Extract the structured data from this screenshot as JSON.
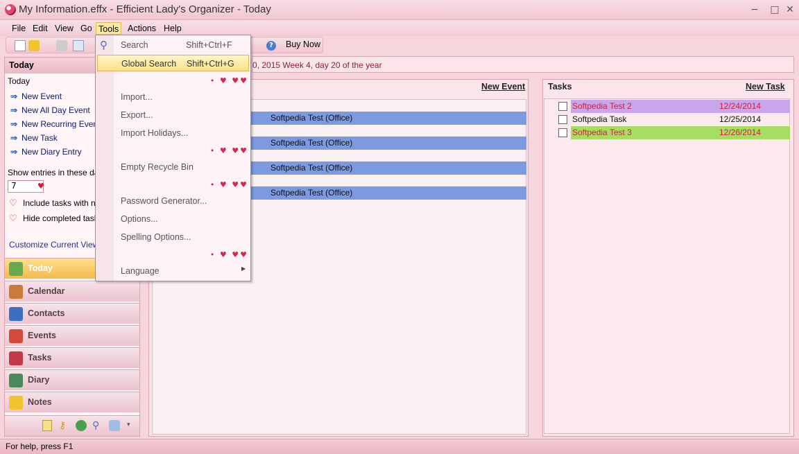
{
  "window": {
    "title": "My Information.effx - Efficient Lady's Organizer - Today",
    "controls": {
      "minimize": "−",
      "maximize": "□",
      "close": "✕"
    }
  },
  "menubar": [
    "File",
    "Edit",
    "View",
    "Go",
    "Tools",
    "Actions",
    "Help"
  ],
  "toolbar": {
    "buy_now": "Buy Now",
    "help_icon": "?"
  },
  "datebar": {
    "text": "0, 2015   Week 4, day 20 of the year"
  },
  "left_pane": {
    "header": "Today",
    "today_label": "Today",
    "links": [
      "New Event",
      "New All Day Event",
      "New Recurring Event",
      "New Task",
      "New Diary Entry"
    ],
    "show_entries_label": "Show entries in these days",
    "days_value": "7",
    "include_tasks_label": "Include tasks with no",
    "hide_completed_label": "Hide completed tasks",
    "customize_link": "Customize Current View...",
    "nav": [
      {
        "label": "Today",
        "icon": "home-icon",
        "color": "#6aa84f"
      },
      {
        "label": "Calendar",
        "icon": "calendar-icon",
        "color": "#c97b3a"
      },
      {
        "label": "Contacts",
        "icon": "contacts-icon",
        "color": "#3c6fc2"
      },
      {
        "label": "Events",
        "icon": "events-icon",
        "color": "#d14a3a"
      },
      {
        "label": "Tasks",
        "icon": "tasks-icon",
        "color": "#c23a4a"
      },
      {
        "label": "Diary",
        "icon": "diary-icon",
        "color": "#4a8a5a"
      },
      {
        "label": "Notes",
        "icon": "notes-icon",
        "color": "#f2c530"
      }
    ]
  },
  "events": {
    "new_event_label": "New Event",
    "rows": [
      "Softpedia Test (Office)",
      "Softpedia Test (Office)",
      "Softpedia Test (Office)",
      "Softpedia Test (Office)"
    ]
  },
  "tasks": {
    "title": "Tasks",
    "new_task_label": "New Task",
    "rows": [
      {
        "name": "Softpedia Test 2",
        "date": "12/24/2014",
        "bg": "#c9a5ec",
        "color": "#d0203c"
      },
      {
        "name": "Softpedia Task",
        "date": "12/25/2014",
        "bg": "",
        "color": "#111111"
      },
      {
        "name": "Softpedia Test 3",
        "date": "12/26/2014",
        "bg": "#a6de62",
        "color": "#d0203c"
      }
    ]
  },
  "tools_menu": {
    "search": {
      "label": "Search",
      "shortcut": "Shift+Ctrl+F"
    },
    "global_search": {
      "label": "Global Search",
      "shortcut": "Shift+Ctrl+G"
    },
    "import": "Import...",
    "export": "Export...",
    "import_holidays": "Import Holidays...",
    "empty_recycle": "Empty Recycle Bin",
    "password_generator": "Password Generator...",
    "options": "Options...",
    "spelling_options": "Spelling Options...",
    "language": "Language"
  },
  "status": "For help, press F1"
}
